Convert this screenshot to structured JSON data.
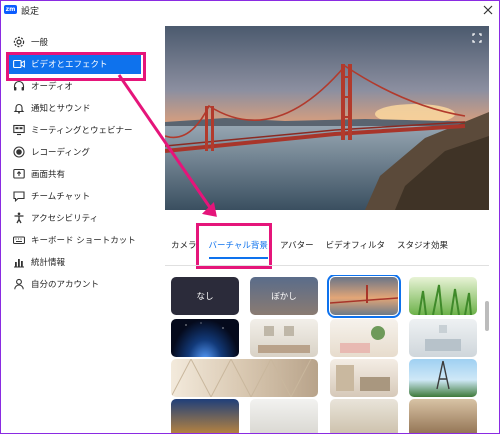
{
  "window": {
    "title": "設定",
    "app_icon": "zm"
  },
  "sidebar": {
    "items": [
      {
        "label": "一般",
        "icon": "gear-icon"
      },
      {
        "label": "ビデオとエフェクト",
        "icon": "video-camera-icon"
      },
      {
        "label": "オーディオ",
        "icon": "headphones-icon"
      },
      {
        "label": "通知とサウンド",
        "icon": "bell-icon"
      },
      {
        "label": "ミーティングとウェビナー",
        "icon": "meeting-icon"
      },
      {
        "label": "レコーディング",
        "icon": "record-icon"
      },
      {
        "label": "画面共有",
        "icon": "screen-share-icon"
      },
      {
        "label": "チームチャット",
        "icon": "chat-icon"
      },
      {
        "label": "アクセシビリティ",
        "icon": "accessibility-icon"
      },
      {
        "label": "キーボード ショートカット",
        "icon": "keyboard-icon"
      },
      {
        "label": "統計情報",
        "icon": "statistics-icon"
      },
      {
        "label": "自分のアカウント",
        "icon": "user-icon"
      }
    ],
    "active_index": 1
  },
  "tabs": [
    {
      "label": "カメラ"
    },
    {
      "label": "バーチャル背景"
    },
    {
      "label": "アバター"
    },
    {
      "label": "ビデオフィルタ"
    },
    {
      "label": "スタジオ効果"
    }
  ],
  "active_tab": 1,
  "backgrounds": {
    "none_label": "なし",
    "blur_label": "ぼかし"
  },
  "colors": {
    "accent": "#0e72ed",
    "highlight": "#e5157a",
    "window_border": "#8a2be2"
  }
}
